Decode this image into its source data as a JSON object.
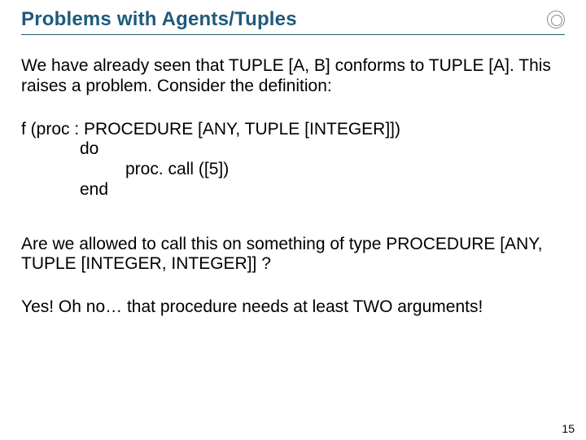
{
  "header": {
    "title": "Problems with Agents/Tuples",
    "logo_name": "circle-logo"
  },
  "intro": "We have already seen that TUPLE [A, B] conforms to TUPLE [A]. This raises a problem. Consider the definition:",
  "code": {
    "sig": "f (proc : PROCEDURE [ANY, TUPLE [INTEGER]])",
    "do_kw": "do",
    "call": "proc. call ([5])",
    "end_kw": "end"
  },
  "question": "Are we allowed to call this on something of type PROCEDURE [ANY, TUPLE [INTEGER, INTEGER]] ?",
  "answer": "Yes! Oh no… that procedure needs at least TWO arguments!",
  "page_number": "15"
}
